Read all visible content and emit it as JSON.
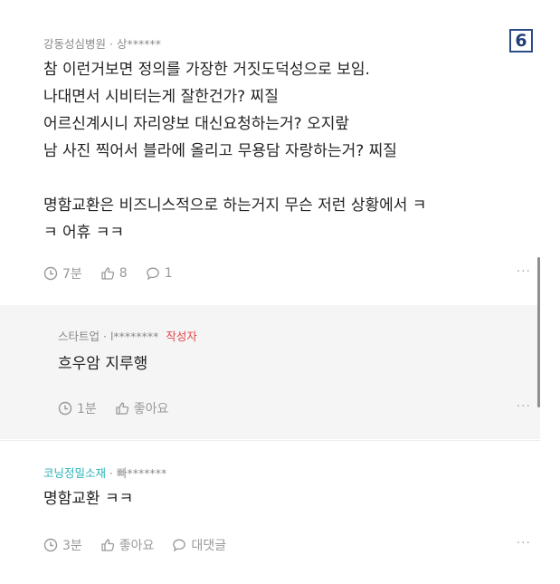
{
  "page_number": "6",
  "comments": [
    {
      "author": "강동성심병원",
      "user": "상******",
      "text": "참 이런거보면 정의를 가장한 거짓도덕성으로 보임.\n나대면서 시비터는게 잘한건가? 찌질\n어르신계시니 자리양보 대신요청하는거? 오지랖\n남 사진 찍어서 블라에 올리고 무용담 자랑하는거? 찌질\n\n명함교환은 비즈니스적으로 하는거지 무슨 저런 상황에서 ㅋ\nㅋ 어휴 ㅋㅋ",
      "time": "7분",
      "likes": "8",
      "replies": "1",
      "more": "···"
    },
    {
      "author": "스타트업",
      "user": "l********",
      "op_label": "작성자",
      "text": "흐우암 지루행",
      "time": "1분",
      "likes": "좋아요",
      "more": "···"
    },
    {
      "author": "코닝정밀소재",
      "user": "빠*******",
      "text": "명함교환 ㅋㅋ",
      "time": "3분",
      "likes": "좋아요",
      "reply_label": "대댓글",
      "more": "···"
    }
  ],
  "colors": {
    "company_highlight": "#2bb3b7",
    "op_label": "#e1474b",
    "reply_background": "#f5f5f5"
  }
}
